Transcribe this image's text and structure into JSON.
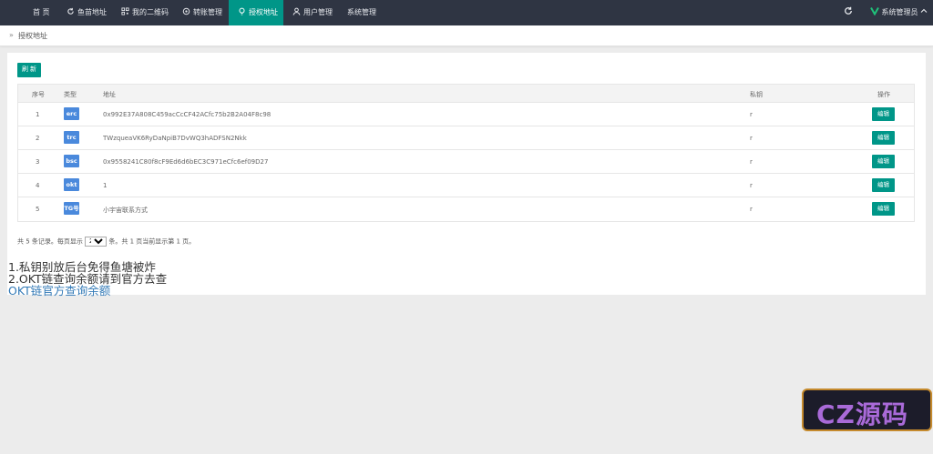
{
  "nav": {
    "items": [
      {
        "label": "首 页",
        "icon": "none"
      },
      {
        "label": "鱼苗地址",
        "icon": "refresh-icon"
      },
      {
        "label": "我的二维码",
        "icon": "qrcode-icon"
      },
      {
        "label": "转账管理",
        "icon": "gear-icon"
      },
      {
        "label": "授权地址",
        "icon": "lightbulb-icon"
      },
      {
        "label": "用户管理",
        "icon": "user-icon"
      },
      {
        "label": "系统管理",
        "icon": "none"
      }
    ],
    "active_index": 4,
    "admin_label": "系统管理员",
    "accent": "#009688",
    "bg": "#2f3543"
  },
  "breadcrumb": {
    "separator": "»",
    "text": "授权地址"
  },
  "toolbar": {
    "refresh_label": "刷 新"
  },
  "table": {
    "headers": {
      "index": "序号",
      "type": "类型",
      "address": "地址",
      "private_key": "私钥",
      "actions": "操作"
    },
    "rows": [
      {
        "index": "1",
        "type": "erc",
        "address": "0x992E37A808C459acCcCF42ACfc75b2B2A04F8c98",
        "private_key": "r",
        "action": "编辑"
      },
      {
        "index": "2",
        "type": "trc",
        "address": "TWzqueaVK6RyDaNpiB7DvWQ3hADFSN2Nkk",
        "private_key": "r",
        "action": "编辑"
      },
      {
        "index": "3",
        "type": "bsc",
        "address": "0x9558241C80f8cF9Ed6d6bEC3C971eCfc6ef09D27",
        "private_key": "r",
        "action": "编辑"
      },
      {
        "index": "4",
        "type": "okt",
        "address": "1",
        "private_key": "r",
        "action": "编辑"
      },
      {
        "index": "5",
        "type": "TG号",
        "address": "小宇宙联系方式",
        "private_key": "r",
        "action": "编辑"
      }
    ]
  },
  "pager": {
    "prefix": "共 5 条记录。每页显示",
    "per_page": "20",
    "suffix": "条。共 1 页当前显示第 1 页。"
  },
  "notes": {
    "line1": "1.私钥别放后台免得鱼塘被炸",
    "line2": "2.OKT链查询余额请到官方去查",
    "link": "OKT链官方查询余额"
  },
  "watermark": {
    "text": "CZ源码"
  }
}
